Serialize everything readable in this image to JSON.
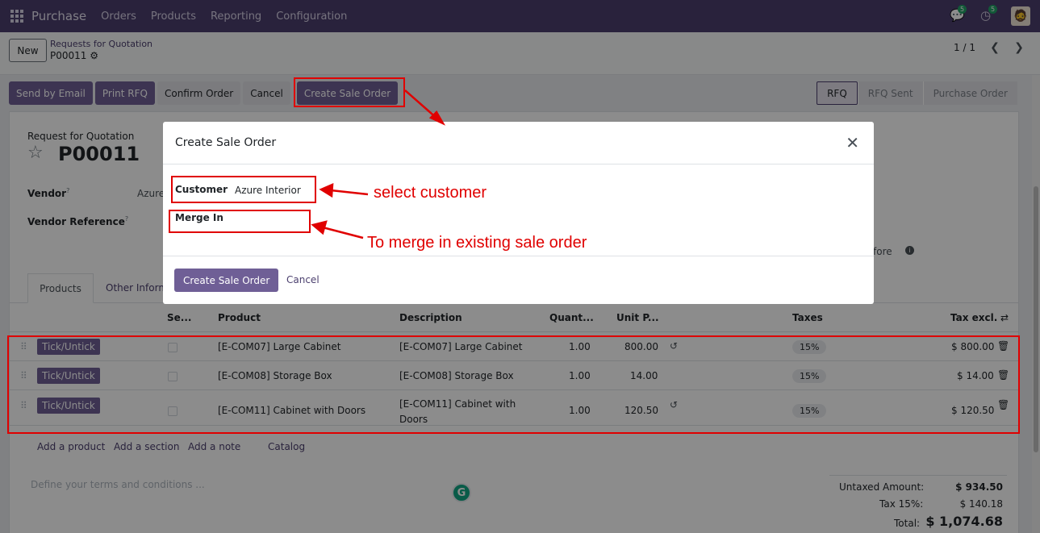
{
  "navbar": {
    "app_name": "Purchase",
    "menu": [
      "Orders",
      "Products",
      "Reporting",
      "Configuration"
    ],
    "chat_badge": "5",
    "activity_badge": "5"
  },
  "control_panel": {
    "new_button": "New",
    "breadcrumb_parent": "Requests for Quotation",
    "breadcrumb_current": "P00011",
    "pager": "1 / 1"
  },
  "action_buttons": {
    "send_email": "Send by Email",
    "print_rfq": "Print RFQ",
    "confirm": "Confirm Order",
    "cancel": "Cancel",
    "create_sale_order": "Create Sale Order"
  },
  "status_bar": [
    "RFQ",
    "RFQ Sent",
    "Purchase Order"
  ],
  "form": {
    "doc_type": "Request for Quotation",
    "name": "P00011",
    "vendor_label": "Vendor",
    "vendor_value": "Azure",
    "vendor_ref_label": "Vendor Reference",
    "tooltip_mark": "?",
    "partial_before": "fore"
  },
  "tabs": {
    "products": "Products",
    "other": "Other Inform"
  },
  "table": {
    "headers": [
      "Se...",
      "Product",
      "Description",
      "Quant...",
      "Unit P...",
      "Taxes",
      "Tax excl."
    ],
    "rows": [
      {
        "tag": "Tick/Untick",
        "product": "[E-COM07] Large Cabinet",
        "description": "[E-COM07] Large Cabinet",
        "qty": "1.00",
        "price": "800.00",
        "tax": "15%",
        "subtotal": "$ 800.00"
      },
      {
        "tag": "Tick/Untick",
        "product": "[E-COM08] Storage Box",
        "description": "[E-COM08] Storage Box",
        "qty": "1.00",
        "price": "14.00",
        "tax": "15%",
        "subtotal": "$ 14.00"
      },
      {
        "tag": "Tick/Untick",
        "product": "[E-COM11] Cabinet with Doors",
        "description": "[E-COM11] Cabinet with Doors",
        "qty": "1.00",
        "price": "120.50",
        "tax": "15%",
        "subtotal": "$ 120.50"
      }
    ],
    "add_links": [
      "Add a product",
      "Add a section",
      "Add a note",
      "Catalog"
    ]
  },
  "terms_placeholder": "Define your terms and conditions ...",
  "totals": {
    "untaxed_label": "Untaxed Amount:",
    "untaxed_value": "$ 934.50",
    "tax_label": "Tax 15%:",
    "tax_value": "$ 140.18",
    "total_label": "Total:",
    "total_value": "$ 1,074.68"
  },
  "modal": {
    "title": "Create Sale Order",
    "customer_label": "Customer",
    "customer_value": "Azure Interior",
    "merge_label": "Merge In",
    "create_button": "Create Sale Order",
    "cancel_button": "Cancel"
  },
  "annotations": {
    "select_customer": "select customer",
    "merge_note": "To merge in existing sale order"
  },
  "colors": {
    "brand": "#4b3f6e",
    "primary_button": "#6f5f96",
    "annotation": "#e00000"
  }
}
